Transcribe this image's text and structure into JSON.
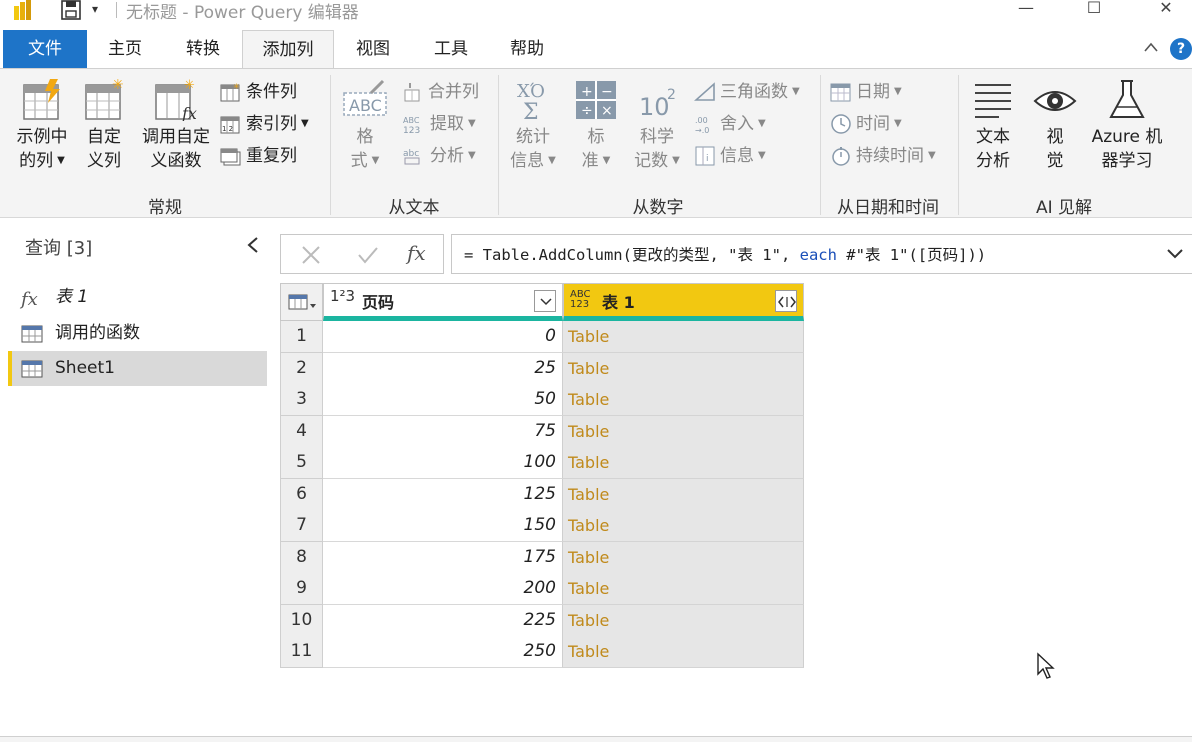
{
  "window": {
    "title": "无标题 - Power Query 编辑器",
    "controls": {
      "minimize": "—",
      "maximize": "☐",
      "close": "✕"
    }
  },
  "tabs": [
    {
      "label": "文件"
    },
    {
      "label": "主页"
    },
    {
      "label": "转换"
    },
    {
      "label": "添加列",
      "active": true
    },
    {
      "label": "视图"
    },
    {
      "label": "工具"
    },
    {
      "label": "帮助"
    }
  ],
  "ribbon": {
    "groups": {
      "general": "常规",
      "from_text": "从文本",
      "from_number": "从数字",
      "from_datetime": "从日期和时间",
      "ai": "AI 见解"
    },
    "general": {
      "example_col_l1": "示例中",
      "example_col_l2": "的列",
      "custom_col_l1": "自定",
      "custom_col_l2": "义列",
      "invoke_fn_l1": "调用自定",
      "invoke_fn_l2": "义函数",
      "conditional_col": "条件列",
      "index_col": "索引列",
      "duplicate_col": "重复列"
    },
    "from_text": {
      "format_l1": "格",
      "format_l2": "式",
      "merge_cols": "合并列",
      "extract": "提取",
      "parse": "分析"
    },
    "from_number": {
      "statistics_l1": "统计",
      "statistics_l2": "信息",
      "standard_l1": "标",
      "standard_l2": "准",
      "scientific_l1": "科学",
      "scientific_l2": "记数",
      "trig": "三角函数",
      "rounding": "舍入",
      "information": "信息"
    },
    "from_datetime": {
      "date": "日期",
      "time": "时间",
      "duration": "持续时间"
    },
    "ai": {
      "text_l1": "文本",
      "text_l2": "分析",
      "vision_l1": "视",
      "vision_l2": "觉",
      "azure_l1": "Azure 机",
      "azure_l2": "器学习"
    }
  },
  "queries_pane": {
    "title": "查询 [3]",
    "items": [
      {
        "label": "表 1",
        "icon": "fx-icon"
      },
      {
        "label": "调用的函数",
        "icon": "table-icon"
      },
      {
        "label": "Sheet1",
        "icon": "table-icon",
        "selected": true
      }
    ]
  },
  "formula_bar": {
    "fx": "fx",
    "part1": "= Table.AddColumn(更改的类型, \"表 1\", ",
    "keyword": "each",
    "part2": " #\"表 1\"([页码]))"
  },
  "grid": {
    "columns": [
      {
        "type": "1²3",
        "name": "页码"
      },
      {
        "type": "ABC/123",
        "name": "表 1"
      }
    ],
    "rows": [
      {
        "n": "1",
        "v": "0",
        "t": "Table"
      },
      {
        "n": "2",
        "v": "25",
        "t": "Table"
      },
      {
        "n": "3",
        "v": "50",
        "t": "Table"
      },
      {
        "n": "4",
        "v": "75",
        "t": "Table"
      },
      {
        "n": "5",
        "v": "100",
        "t": "Table"
      },
      {
        "n": "6",
        "v": "125",
        "t": "Table"
      },
      {
        "n": "7",
        "v": "150",
        "t": "Table"
      },
      {
        "n": "8",
        "v": "175",
        "t": "Table"
      },
      {
        "n": "9",
        "v": "200",
        "t": "Table"
      },
      {
        "n": "10",
        "v": "225",
        "t": "Table"
      },
      {
        "n": "11",
        "v": "250",
        "t": "Table"
      }
    ]
  },
  "colors": {
    "accent_blue": "#1e74c8",
    "selected_col": "#f2c811",
    "quality_bar": "#1bb5a0",
    "table_link": "#c08a1b"
  }
}
